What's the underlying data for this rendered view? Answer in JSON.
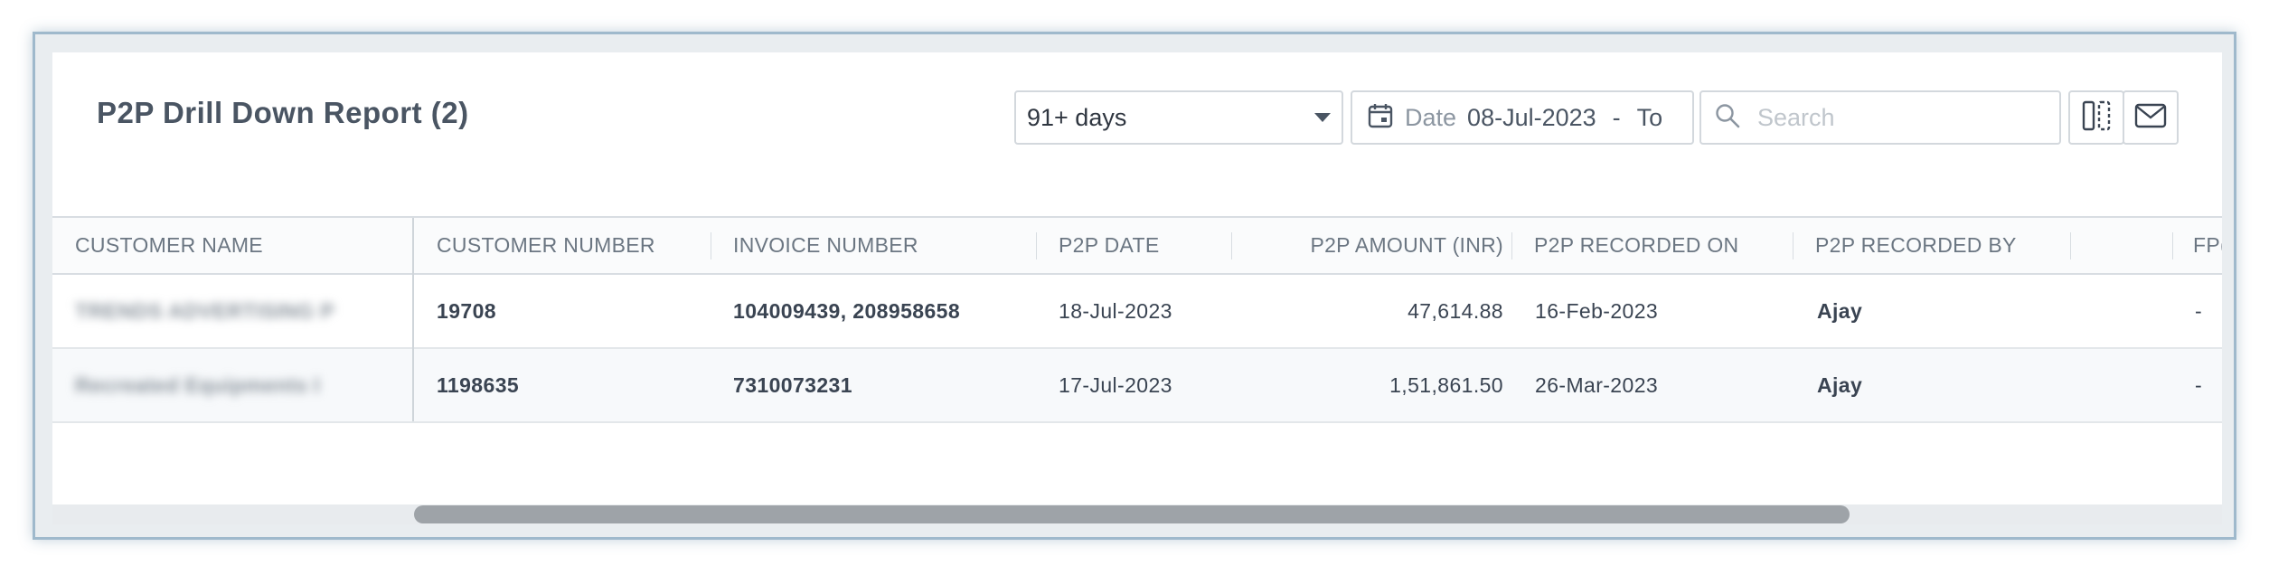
{
  "report": {
    "title": "P2P Drill Down Report (2)"
  },
  "filters": {
    "period_value": "91+ days",
    "date_label": "Date",
    "date_from": "08-Jul-2023",
    "date_separator": "-",
    "date_to": "To",
    "search_placeholder": "Search"
  },
  "icons": {
    "dropdown": "chevron-down-icon",
    "calendar": "calendar-icon",
    "search": "search-icon",
    "columns": "columns-icon",
    "email": "mail-icon"
  },
  "table": {
    "columns": [
      "CUSTOMER NAME",
      "CUSTOMER NUMBER",
      "INVOICE NUMBER",
      "P2P DATE",
      "P2P AMOUNT (INR)",
      "P2P RECORDED ON",
      "P2P RECORDED BY",
      "",
      "FP("
    ],
    "rows": [
      {
        "customer_name": "TRENDS ADVERTISING P",
        "customer_number": "19708",
        "invoice_number": "104009439, 208958658",
        "p2p_date": "18-Jul-2023",
        "p2p_amount": "47,614.88",
        "recorded_on": "16-Feb-2023",
        "recorded_by": "Ajay",
        "fp": "-"
      },
      {
        "customer_name": "Recreated Equipments I",
        "customer_number": "1198635",
        "invoice_number": "7310073231",
        "p2p_date": "17-Jul-2023",
        "p2p_amount": "1,51,861.50",
        "recorded_on": "26-Mar-2023",
        "recorded_by": "Ajay",
        "fp": "-"
      }
    ]
  }
}
